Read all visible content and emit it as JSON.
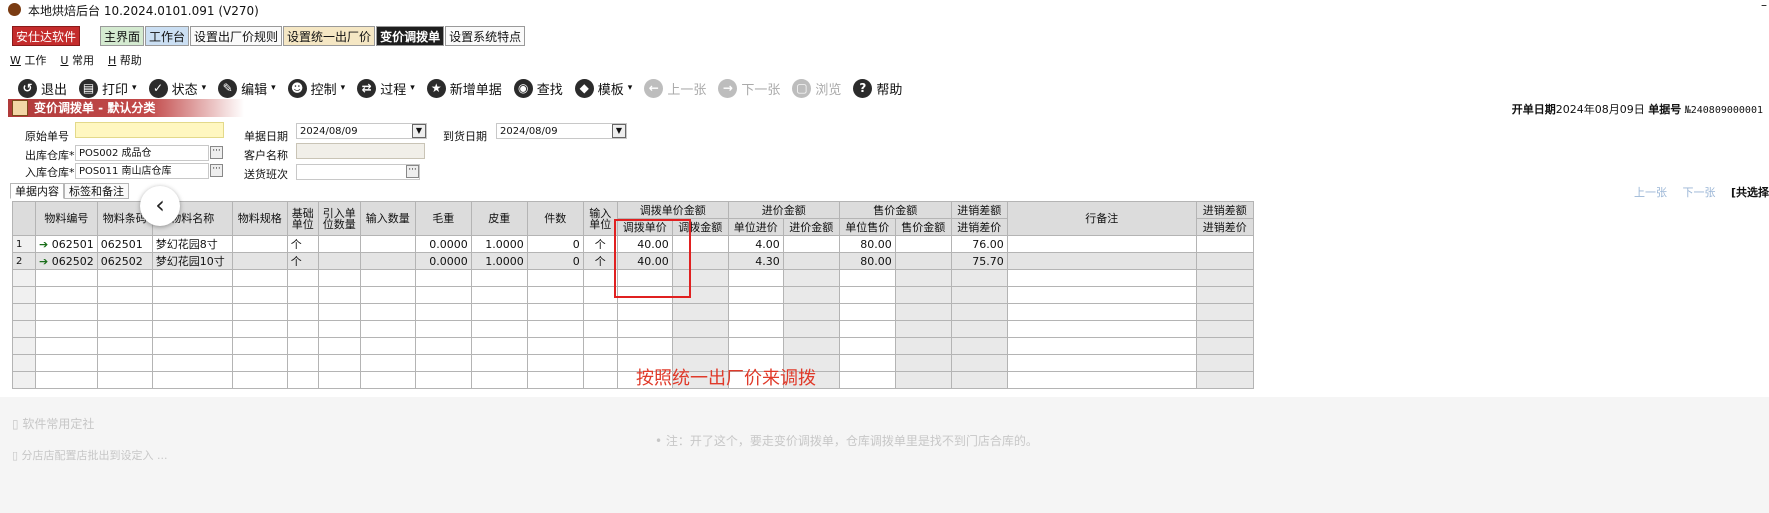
{
  "window": {
    "title": "本地烘焙后台   10.2024.0101.091 (V270)",
    "minimize": "–"
  },
  "brand_button": "安仕达软件",
  "tabs": [
    {
      "label": "主界面",
      "style": "green"
    },
    {
      "label": "工作台",
      "style": "blue"
    },
    {
      "label": "设置出厂价规则",
      "style": "white"
    },
    {
      "label": "设置统一出厂价",
      "style": "beige"
    },
    {
      "label": "变价调拨单",
      "style": "active"
    },
    {
      "label": "设置系统特点",
      "style": "white"
    }
  ],
  "menu": [
    {
      "key": "W",
      "label": "工作"
    },
    {
      "key": "U",
      "label": "常用"
    },
    {
      "key": "H",
      "label": "帮助"
    }
  ],
  "toolbar": [
    {
      "label": "退出",
      "icon": "exit-icon",
      "glyph": "↺",
      "dropdown": false,
      "disabled": false
    },
    {
      "label": "打印",
      "icon": "print-icon",
      "glyph": "▤",
      "dropdown": true,
      "disabled": false
    },
    {
      "label": "状态",
      "icon": "check-icon",
      "glyph": "✓",
      "dropdown": true,
      "disabled": false
    },
    {
      "label": "编辑",
      "icon": "edit-icon",
      "glyph": "✎",
      "dropdown": true,
      "disabled": false
    },
    {
      "label": "控制",
      "icon": "user-icon",
      "glyph": "☻",
      "dropdown": true,
      "disabled": false
    },
    {
      "label": "过程",
      "icon": "process-icon",
      "glyph": "⇄",
      "dropdown": true,
      "disabled": false
    },
    {
      "label": "新增单据",
      "icon": "star-icon",
      "glyph": "★",
      "dropdown": false,
      "disabled": false
    },
    {
      "label": "查找",
      "icon": "search-icon",
      "glyph": "◉",
      "dropdown": false,
      "disabled": false
    },
    {
      "label": "模板",
      "icon": "template-icon",
      "glyph": "◆",
      "dropdown": true,
      "disabled": false
    },
    {
      "label": "上一张",
      "icon": "prev-icon",
      "glyph": "←",
      "dropdown": false,
      "disabled": true
    },
    {
      "label": "下一张",
      "icon": "next-icon",
      "glyph": "→",
      "dropdown": false,
      "disabled": true
    },
    {
      "label": "浏览",
      "icon": "browse-icon",
      "glyph": "▢",
      "dropdown": false,
      "disabled": true
    },
    {
      "label": "帮助",
      "icon": "help-icon",
      "glyph": "?",
      "dropdown": false,
      "disabled": false
    }
  ],
  "form": {
    "title": "变价调拨单 - 默认分类",
    "open_date_label": "开单日期",
    "open_date": "2024年08月09日",
    "doc_no_label": "单据号",
    "doc_no": "№240809000001",
    "orig_no_label": "原始单号",
    "orig_no": "",
    "out_wh_label": "出库仓库*",
    "out_wh": "POS002 成品仓",
    "in_wh_label": "入库仓库*",
    "in_wh": "POS011 南山店仓库",
    "doc_date_label": "单据日期",
    "doc_date": "2024/08/09",
    "customer_label": "客户名称",
    "customer": "",
    "shift_label": "送货班次",
    "shift": "",
    "arrive_label": "到货日期",
    "arrive_date": "2024/08/09"
  },
  "subtabs": [
    "单据内容",
    "标签和备注"
  ],
  "nav": {
    "prev": "上一张",
    "next": "下一张",
    "total": "[共选择"
  },
  "table": {
    "headers": {
      "code": "物料编号",
      "barcode": "物料条码",
      "name": "物料名称",
      "spec": "物料规格",
      "base_unit": "基础单位",
      "ref_qty": "引入单位数量",
      "in_qty": "输入数量",
      "gross": "毛重",
      "tare": "皮重",
      "pieces": "件数",
      "in_unit": "输入单位",
      "grp_transfer": "调拨单价金额",
      "transfer_price": "调拨单价",
      "transfer_amt": "调拨金额",
      "grp_purchase": "进价金额",
      "unit_purchase": "单位进价",
      "purchase_amt": "进价金额",
      "grp_sale": "售价金额",
      "unit_sale": "单位售价",
      "sale_amt": "售价金额",
      "grp_diff": "进销差额",
      "diff_price": "进销差价",
      "remark": "行备注",
      "grp_diff2": "进销差额",
      "diff_price2": "进销差价"
    },
    "rows": [
      {
        "rn": "1",
        "code": "062501",
        "barcode": "062501",
        "name": "梦幻花园8寸",
        "spec": "",
        "base_unit": "个",
        "ref_qty": "",
        "in_qty": "",
        "gross": "0.0000",
        "tare": "1.0000",
        "pieces": "0",
        "in_unit": "个",
        "transfer_price": "40.00",
        "transfer_amt": "",
        "unit_purchase": "4.00",
        "purchase_amt": "",
        "unit_sale": "80.00",
        "sale_amt": "",
        "diff_price": "76.00",
        "remark": "",
        "diff_price2": ""
      },
      {
        "rn": "2",
        "code": "062502",
        "barcode": "062502",
        "name": "梦幻花园10寸",
        "spec": "",
        "base_unit": "个",
        "ref_qty": "",
        "in_qty": "",
        "gross": "0.0000",
        "tare": "1.0000",
        "pieces": "0",
        "in_unit": "个",
        "transfer_price": "40.00",
        "transfer_amt": "",
        "unit_purchase": "4.30",
        "purchase_amt": "",
        "unit_sale": "80.00",
        "sale_amt": "",
        "diff_price": "75.70",
        "remark": "",
        "diff_price2": ""
      }
    ]
  },
  "annotation": "按照统一出厂价来调拨",
  "overlay": {
    "line1": "▯ 软件常用定社",
    "line2": "• 注：开了这个，要走变价调拨单，仓库调拨单里是找不到门店合库的。",
    "line3": "▯ 分店店配置店批出到设定入 ..."
  },
  "colors": {
    "accent_red": "#c42c2c",
    "annotation_red": "#e03a2a",
    "active_tab": "#1e1e1e"
  }
}
